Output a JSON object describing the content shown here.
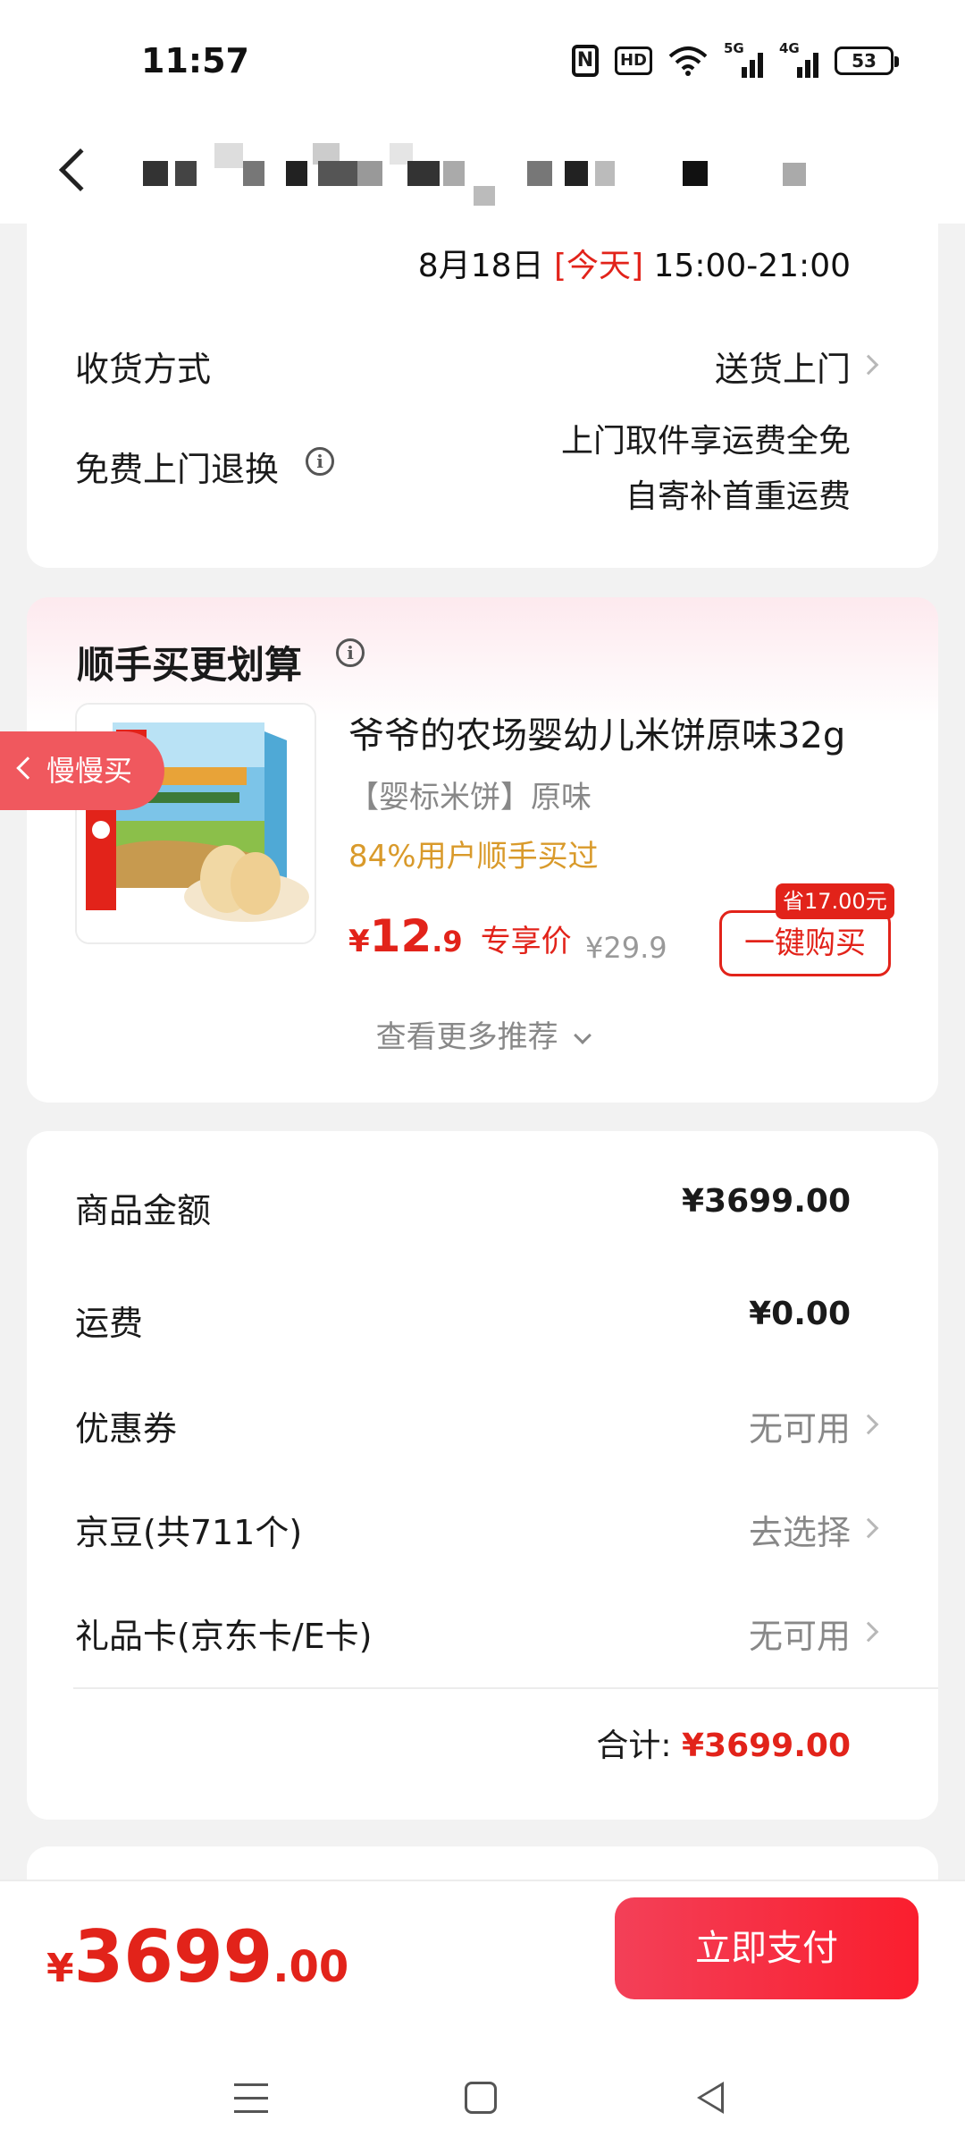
{
  "status_bar": {
    "time": "11:57",
    "icons": [
      "nfc-icon",
      "hd-icon",
      "wifi-icon",
      "5g-signal-icon",
      "4g-signal-icon",
      "battery-icon"
    ],
    "hd_label": "HD",
    "sig1_label": "5G",
    "sig2_label": "4G",
    "battery_level": "53"
  },
  "header": {
    "back_icon": "chevron-left-icon"
  },
  "delivery": {
    "date": "8月18日",
    "today": "[今天]",
    "time_range": "15:00-21:00",
    "method_label": "收货方式",
    "method_value": "送货上门",
    "return_label": "免费上门退换",
    "return_value_line1": "上门取件享运费全免",
    "return_value_line2": "自寄补首重运费"
  },
  "recommend": {
    "title": "顺手买更划算",
    "product_name": "爷爷的农场婴幼儿米饼原味32g",
    "product_tag": "【婴标米饼】原味",
    "product_stat": "84%用户顺手买过",
    "price_currency": "¥",
    "price_integer": "12",
    "price_decimal": ".9",
    "price_tag": "专享价",
    "original_price": "¥29.9",
    "save_badge": "省17.00元",
    "buy_button": "一键购买",
    "more_link": "查看更多推荐"
  },
  "floating": {
    "label": "慢慢买"
  },
  "summary": {
    "rows": [
      {
        "label": "商品金额",
        "value": "¥3699.00",
        "style": "amount"
      },
      {
        "label": "运费",
        "value": "¥0.00",
        "style": "amount"
      },
      {
        "label": "优惠券",
        "value": "无可用",
        "style": "link"
      },
      {
        "label": "京豆(共711个)",
        "value": "去选择",
        "style": "link"
      },
      {
        "label": "礼品卡(京东卡/E卡)",
        "value": "无可用",
        "style": "link"
      }
    ],
    "total_label": "合计:",
    "total_value": "¥3699.00"
  },
  "bottom_bar": {
    "currency": "¥",
    "price_integer": "3699",
    "price_decimal": ".00",
    "pay_button": "立即支付"
  },
  "nav_bar": {
    "icons": [
      "menu-icon",
      "home-icon",
      "back-icon"
    ]
  },
  "colors": {
    "accent": "#e2231a",
    "highlight": "#d99a2b",
    "muted": "#888888"
  }
}
